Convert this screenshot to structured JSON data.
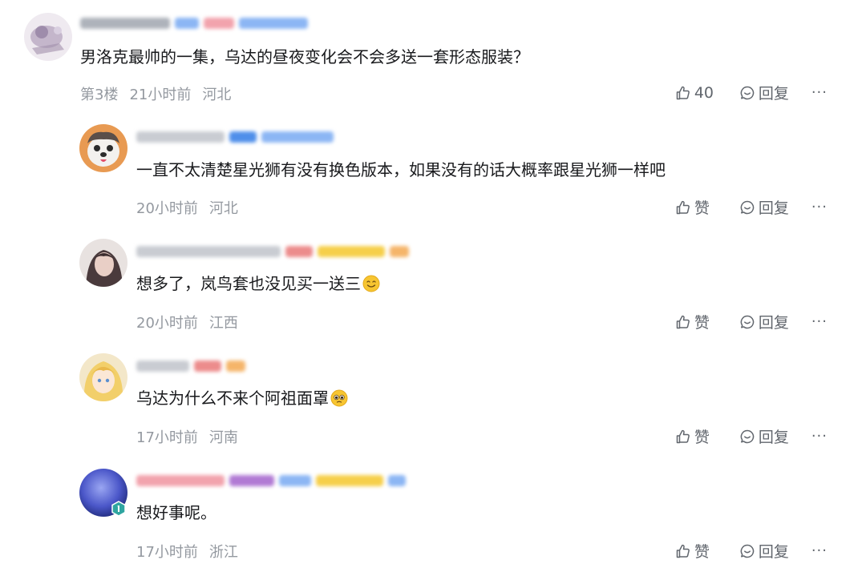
{
  "comments": [
    {
      "text": "男洛克最帅的一集，乌达的昼夜变化会不会多送一套形态服装？",
      "floor": "第3楼",
      "time": "21小时前",
      "region": "河北",
      "like_label": "40",
      "reply_label": "回复"
    },
    {
      "text": "一直不太清楚星光狮有没有换色版本，如果没有的话大概率跟星光狮一样吧",
      "time": "20小时前",
      "region": "河北",
      "like_label": "赞",
      "reply_label": "回复"
    },
    {
      "text": "想多了，岚鸟套也没见买一送三",
      "emoji": "smile-emoji",
      "time": "20小时前",
      "region": "江西",
      "like_label": "赞",
      "reply_label": "回复"
    },
    {
      "text": "乌达为什么不来个阿祖面罩",
      "emoji": "pleading-emoji",
      "time": "17小时前",
      "region": "河南",
      "like_label": "赞",
      "reply_label": "回复"
    },
    {
      "text": "想好事呢。",
      "time": "17小时前",
      "region": "浙江",
      "like_label": "赞",
      "reply_label": "回复"
    }
  ],
  "more_label": "···",
  "colors": {
    "text": "#18191c",
    "meta": "#9499a0",
    "action": "#61666d",
    "level_badge": "#2fa5a0"
  }
}
